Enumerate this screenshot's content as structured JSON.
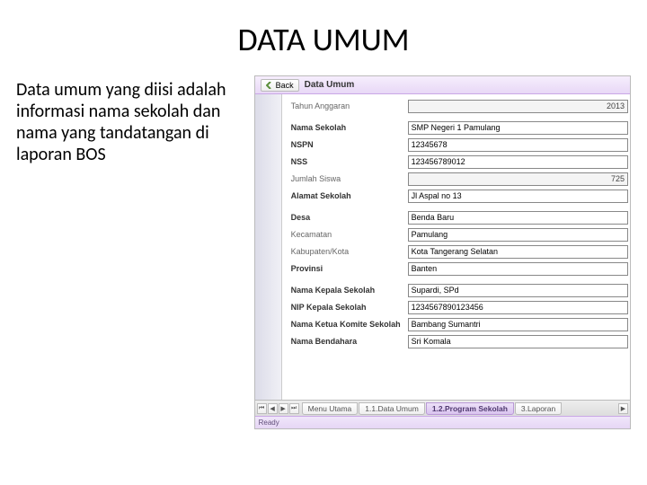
{
  "slide": {
    "title": "DATA UMUM",
    "description": "Data umum yang diisi adalah informasi nama sekolah dan nama yang tandatangan di laporan BOS"
  },
  "app": {
    "back_label": "Back",
    "header_title": "Data Umum",
    "status": "Ready",
    "fields": {
      "tahun_anggaran": {
        "label": "Tahun Anggaran",
        "value": "2013"
      },
      "nama_sekolah": {
        "label": "Nama Sekolah",
        "value": "SMP Negeri 1 Pamulang"
      },
      "nspn": {
        "label": "NSPN",
        "value": "12345678"
      },
      "nss": {
        "label": "NSS",
        "value": "123456789012"
      },
      "jumlah_siswa": {
        "label": "Jumlah Siswa",
        "value": "725"
      },
      "alamat_sekolah": {
        "label": "Alamat Sekolah",
        "value": "Jl Aspal no 13"
      },
      "desa": {
        "label": "Desa",
        "value": "Benda Baru"
      },
      "kecamatan": {
        "label": "Kecamatan",
        "value": "Pamulang"
      },
      "kabupaten": {
        "label": "Kabupaten/Kota",
        "value": "Kota Tangerang Selatan"
      },
      "provinsi": {
        "label": "Provinsi",
        "value": "Banten"
      },
      "nama_kepsek": {
        "label": "Nama Kepala Sekolah",
        "value": "Supardi, SPd"
      },
      "nip_kepsek": {
        "label": "NIP Kepala Sekolah",
        "value": "1234567890123456"
      },
      "ketua_komite": {
        "label": "Nama Ketua Komite Sekolah",
        "value": "Bambang Sumantri"
      },
      "nama_bendahara": {
        "label": "Nama Bendahara",
        "value": "Sri Komala"
      }
    },
    "tabs": {
      "menu_utama": "Menu Utama",
      "data_umum": "1.1.Data Umum",
      "program_sekolah": "1.2.Program Sekolah",
      "laporan": "3.Laporan"
    }
  }
}
